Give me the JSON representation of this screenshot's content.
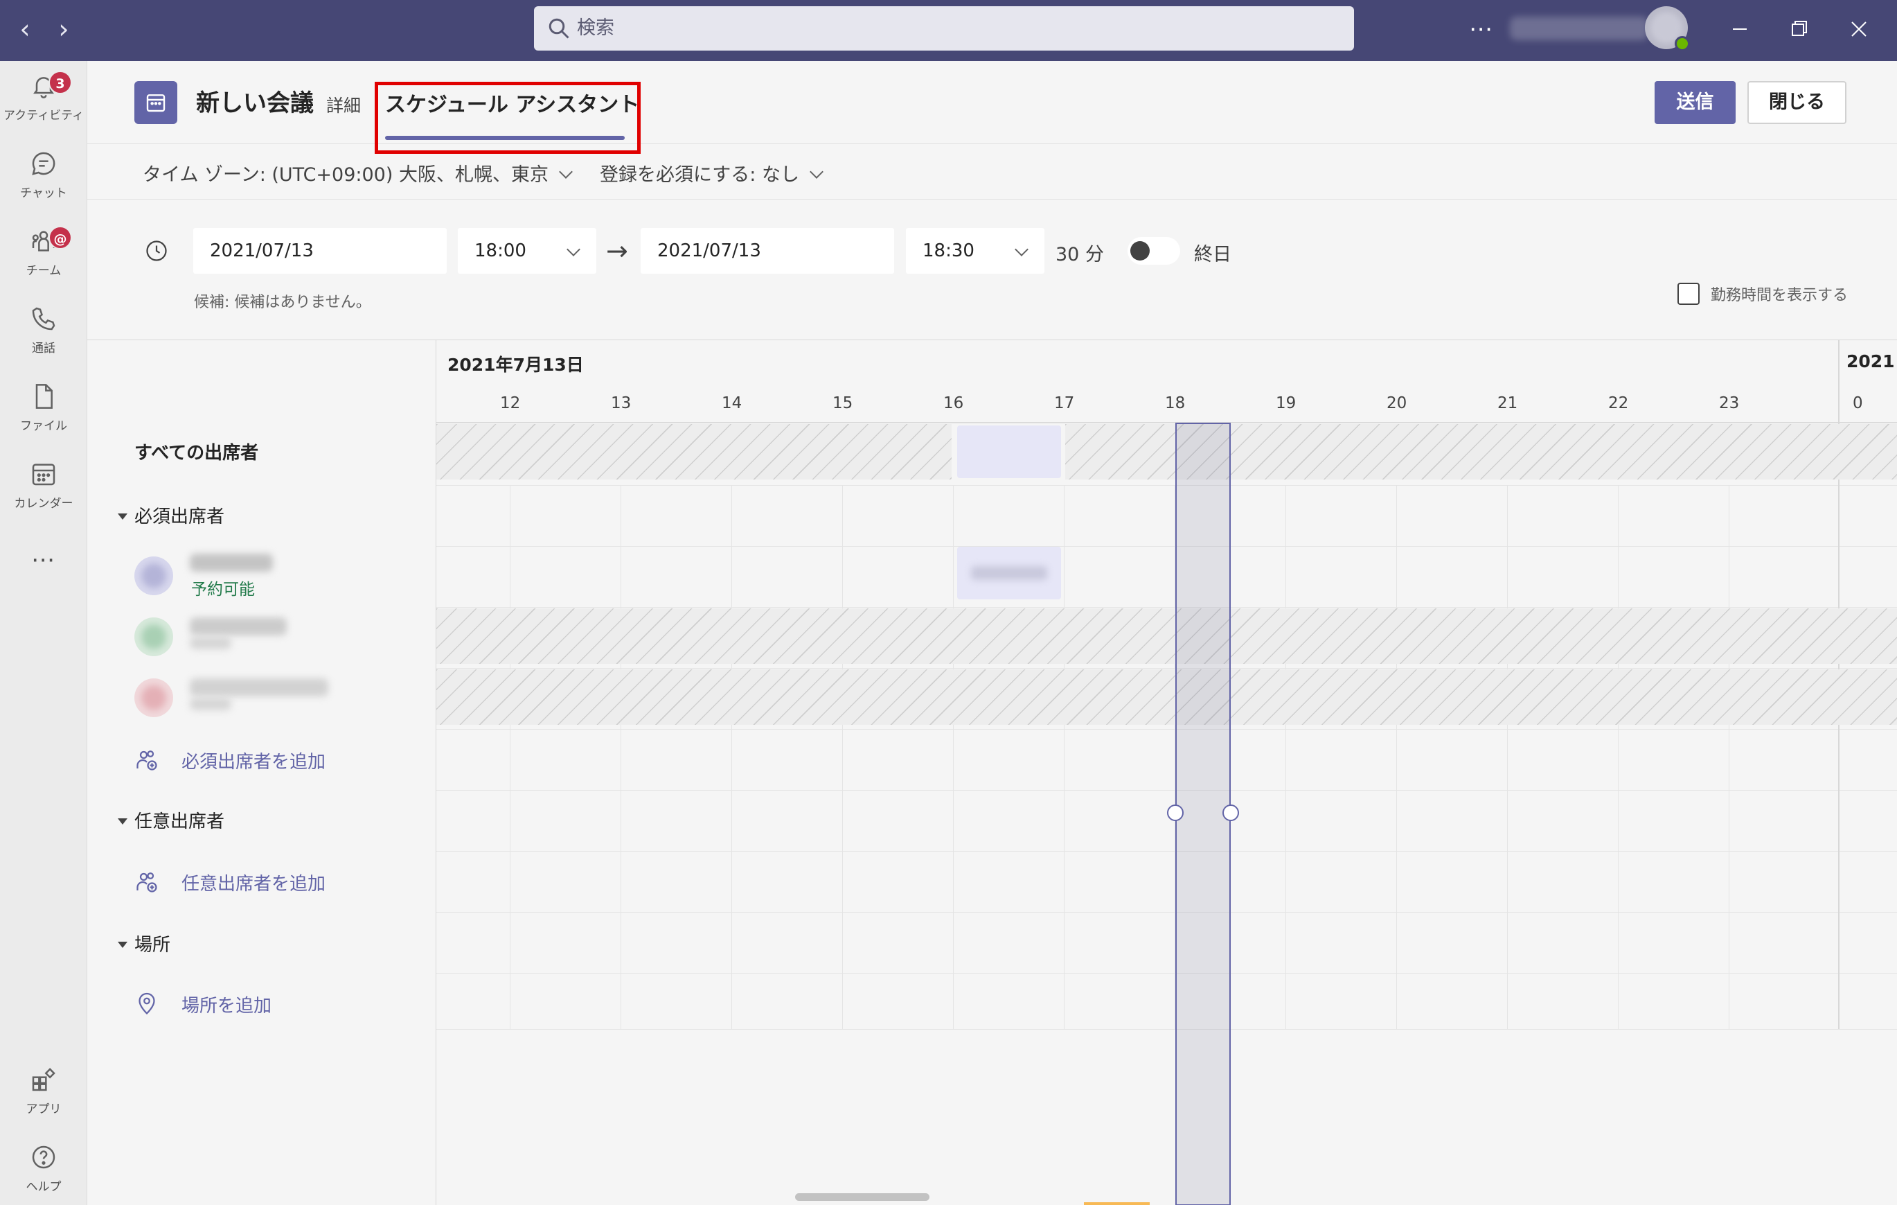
{
  "search": {
    "placeholder": "検索"
  },
  "titlebar": {
    "more_label": "⋯"
  },
  "rail": {
    "items": [
      {
        "label": "アクティビティ",
        "badge": "3"
      },
      {
        "label": "チャット"
      },
      {
        "label": "チーム",
        "badge": "@"
      },
      {
        "label": "通話"
      },
      {
        "label": "ファイル"
      },
      {
        "label": "カレンダー"
      }
    ],
    "more": "⋯",
    "bottom": [
      {
        "label": "アプリ"
      },
      {
        "label": "ヘルプ"
      }
    ]
  },
  "header": {
    "title": "新しい会議",
    "tab_details": "詳細",
    "tab_scheduler": "スケジュール アシスタント",
    "send": "送信",
    "close": "閉じる"
  },
  "options": {
    "timezone": "タイム ゾーン: (UTC+09:00) 大阪、札幌、東京",
    "registration": "登録を必須にする: なし"
  },
  "datetime": {
    "start_date": "2021/07/13",
    "start_time": "18:00",
    "end_date": "2021/07/13",
    "end_time": "18:30",
    "duration": "30 分",
    "all_day": "終日",
    "suggestion": "候補: 候補はありません。",
    "show_work_hours": "勤務時間を表示する"
  },
  "scheduler": {
    "all_attendees": "すべての出席者",
    "required_section": "必須出席者",
    "attendee_status": "予約可能",
    "add_required": "必須出席者を追加",
    "optional_section": "任意出席者",
    "add_optional": "任意出席者を追加",
    "location_section": "場所",
    "add_location": "場所を追加",
    "date_label": "2021年7月13日",
    "next_date_label": "2021",
    "hours": [
      "12",
      "13",
      "14",
      "15",
      "16",
      "17",
      "18",
      "19",
      "20",
      "21",
      "22",
      "23",
      "0"
    ]
  },
  "colors": {
    "titlebar": "#464775",
    "accent": "#6264a7",
    "badge": "#c4314b",
    "available": "#237b4b",
    "highlight": "#e00000"
  }
}
